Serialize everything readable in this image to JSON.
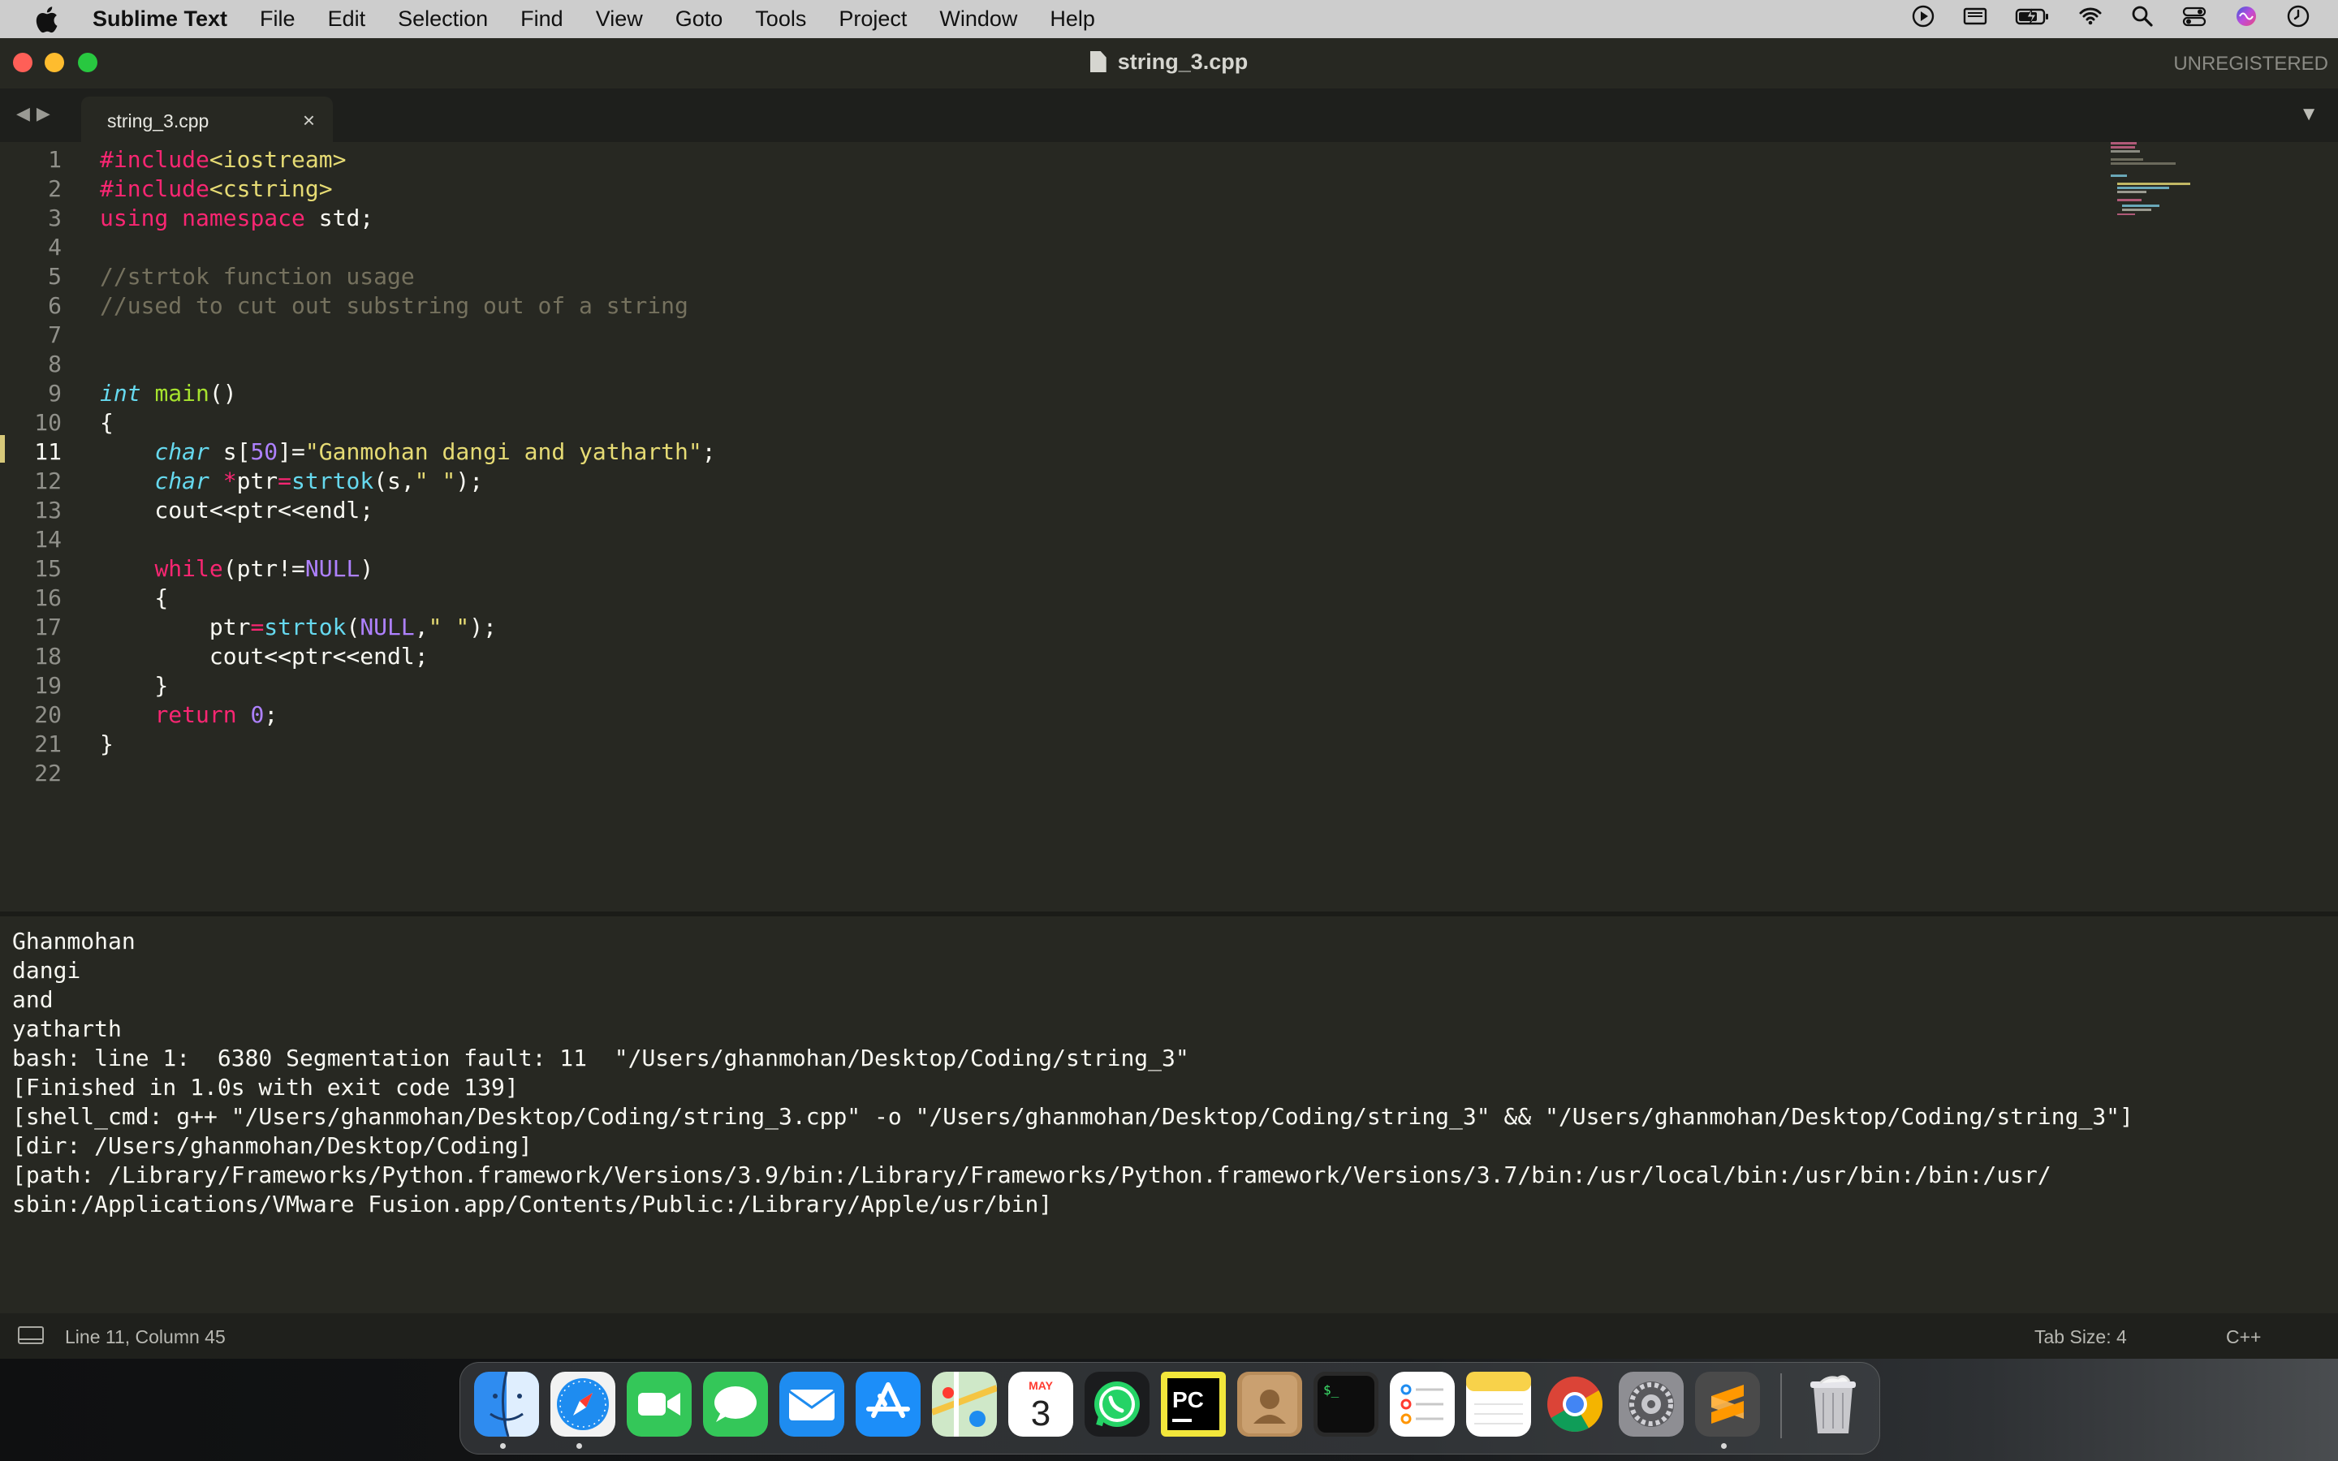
{
  "menubar": {
    "app_name": "Sublime Text",
    "items": [
      "File",
      "Edit",
      "Selection",
      "Find",
      "View",
      "Goto",
      "Tools",
      "Project",
      "Window",
      "Help"
    ],
    "status_icons": [
      "play-icon",
      "display-icon",
      "battery-icon",
      "wifi-icon",
      "spotlight-search-icon",
      "control-center-icon",
      "siri-icon",
      "clock-icon"
    ]
  },
  "window": {
    "title": "string_3.cpp",
    "license": "UNREGISTERED"
  },
  "tabs": [
    {
      "label": "string_3.cpp",
      "close": "×",
      "active": true
    }
  ],
  "nav": {
    "back": "◀",
    "forward": "▶",
    "tab_menu": "▼"
  },
  "editor": {
    "active_line": 11,
    "line_numbers": [
      "1",
      "2",
      "3",
      "4",
      "5",
      "6",
      "7",
      "8",
      "9",
      "10",
      "11",
      "12",
      "13",
      "14",
      "15",
      "16",
      "17",
      "18",
      "19",
      "20",
      "21",
      "22"
    ],
    "lines": [
      [
        {
          "t": "#include",
          "c": "k"
        },
        {
          "t": "<iostream>",
          "c": "s"
        }
      ],
      [
        {
          "t": "#include",
          "c": "k"
        },
        {
          "t": "<cstring>",
          "c": "s"
        }
      ],
      [
        {
          "t": "using",
          "c": "k"
        },
        {
          "t": " "
        },
        {
          "t": "namespace",
          "c": "k"
        },
        {
          "t": " std;"
        }
      ],
      [],
      [
        {
          "t": "//strtok function usage",
          "c": "c"
        }
      ],
      [
        {
          "t": "//used to cut out substring out of a string",
          "c": "c"
        }
      ],
      [],
      [],
      [
        {
          "t": "int",
          "c": "t"
        },
        {
          "t": " "
        },
        {
          "t": "main",
          "c": "f"
        },
        {
          "t": "()"
        }
      ],
      [
        {
          "t": "{"
        }
      ],
      [
        {
          "t": "    "
        },
        {
          "t": "char",
          "c": "t"
        },
        {
          "t": " s["
        },
        {
          "t": "50",
          "c": "n"
        },
        {
          "t": "]="
        },
        {
          "t": "\"Ganmohan dangi and yatharth\"",
          "c": "s"
        },
        {
          "t": ";"
        }
      ],
      [
        {
          "t": "    "
        },
        {
          "t": "char",
          "c": "t"
        },
        {
          "t": " "
        },
        {
          "t": "*",
          "c": "k"
        },
        {
          "t": "ptr"
        },
        {
          "t": "=",
          "c": "k"
        },
        {
          "t": "strtok",
          "c": "b"
        },
        {
          "t": "(s,"
        },
        {
          "t": "\" \"",
          "c": "s"
        },
        {
          "t": ");"
        }
      ],
      [
        {
          "t": "    cout<<ptr<<endl;"
        }
      ],
      [],
      [
        {
          "t": "    "
        },
        {
          "t": "while",
          "c": "k"
        },
        {
          "t": "(ptr!="
        },
        {
          "t": "NULL",
          "c": "n"
        },
        {
          "t": ")"
        }
      ],
      [
        {
          "t": "    {"
        }
      ],
      [
        {
          "t": "        ptr"
        },
        {
          "t": "=",
          "c": "k"
        },
        {
          "t": "strtok",
          "c": "b"
        },
        {
          "t": "("
        },
        {
          "t": "NULL",
          "c": "n"
        },
        {
          "t": ","
        },
        {
          "t": "\" \"",
          "c": "s"
        },
        {
          "t": ");"
        }
      ],
      [
        {
          "t": "        cout<<ptr<<endl;"
        }
      ],
      [
        {
          "t": "    }"
        }
      ],
      [
        {
          "t": "    "
        },
        {
          "t": "return",
          "c": "k"
        },
        {
          "t": " "
        },
        {
          "t": "0",
          "c": "n"
        },
        {
          "t": ";"
        }
      ],
      [
        {
          "t": "}"
        }
      ],
      []
    ]
  },
  "output": {
    "lines": [
      "Ghanmohan",
      "dangi",
      "and",
      "yatharth",
      "bash: line 1:  6380 Segmentation fault: 11  \"/Users/ghanmohan/Desktop/Coding/string_3\"",
      "[Finished in 1.0s with exit code 139]",
      "[shell_cmd: g++ \"/Users/ghanmohan/Desktop/Coding/string_3.cpp\" -o \"/Users/ghanmohan/Desktop/Coding/string_3\" && \"/Users/ghanmohan/Desktop/Coding/string_3\"]",
      "[dir: /Users/ghanmohan/Desktop/Coding]",
      "[path: /Library/Frameworks/Python.framework/Versions/3.9/bin:/Library/Frameworks/Python.framework/Versions/3.7/bin:/usr/local/bin:/usr/bin:/bin:/usr/",
      "sbin:/Applications/VMware Fusion.app/Contents/Public:/Library/Apple/usr/bin]"
    ]
  },
  "statusbar": {
    "position": "Line 11, Column 45",
    "tab_size": "Tab Size: 4",
    "syntax": "C++"
  },
  "dock": {
    "apps": [
      {
        "name": "finder",
        "running": true
      },
      {
        "name": "safari",
        "running": true
      },
      {
        "name": "facetime",
        "running": false
      },
      {
        "name": "messages",
        "running": false
      },
      {
        "name": "mail",
        "running": false
      },
      {
        "name": "app-store",
        "running": false
      },
      {
        "name": "maps",
        "running": false
      },
      {
        "name": "calendar",
        "running": false,
        "month": "MAY",
        "day": "3"
      },
      {
        "name": "whatsapp",
        "running": false
      },
      {
        "name": "pycharm",
        "running": false,
        "text": "PC"
      },
      {
        "name": "contacts",
        "running": false
      },
      {
        "name": "terminal",
        "running": false,
        "text": "$_"
      },
      {
        "name": "reminders",
        "running": false
      },
      {
        "name": "notes",
        "running": false
      },
      {
        "name": "chrome",
        "running": false
      },
      {
        "name": "system-preferences",
        "running": false
      },
      {
        "name": "sublime-text",
        "running": true
      },
      {
        "name": "trash",
        "running": false
      }
    ]
  },
  "colors": {
    "editor_bg": "#272822",
    "keyword": "#f92672",
    "string": "#e6db74",
    "comment": "#75715e",
    "type": "#66d9ef",
    "function": "#a6e22e",
    "number": "#ae81ff"
  }
}
